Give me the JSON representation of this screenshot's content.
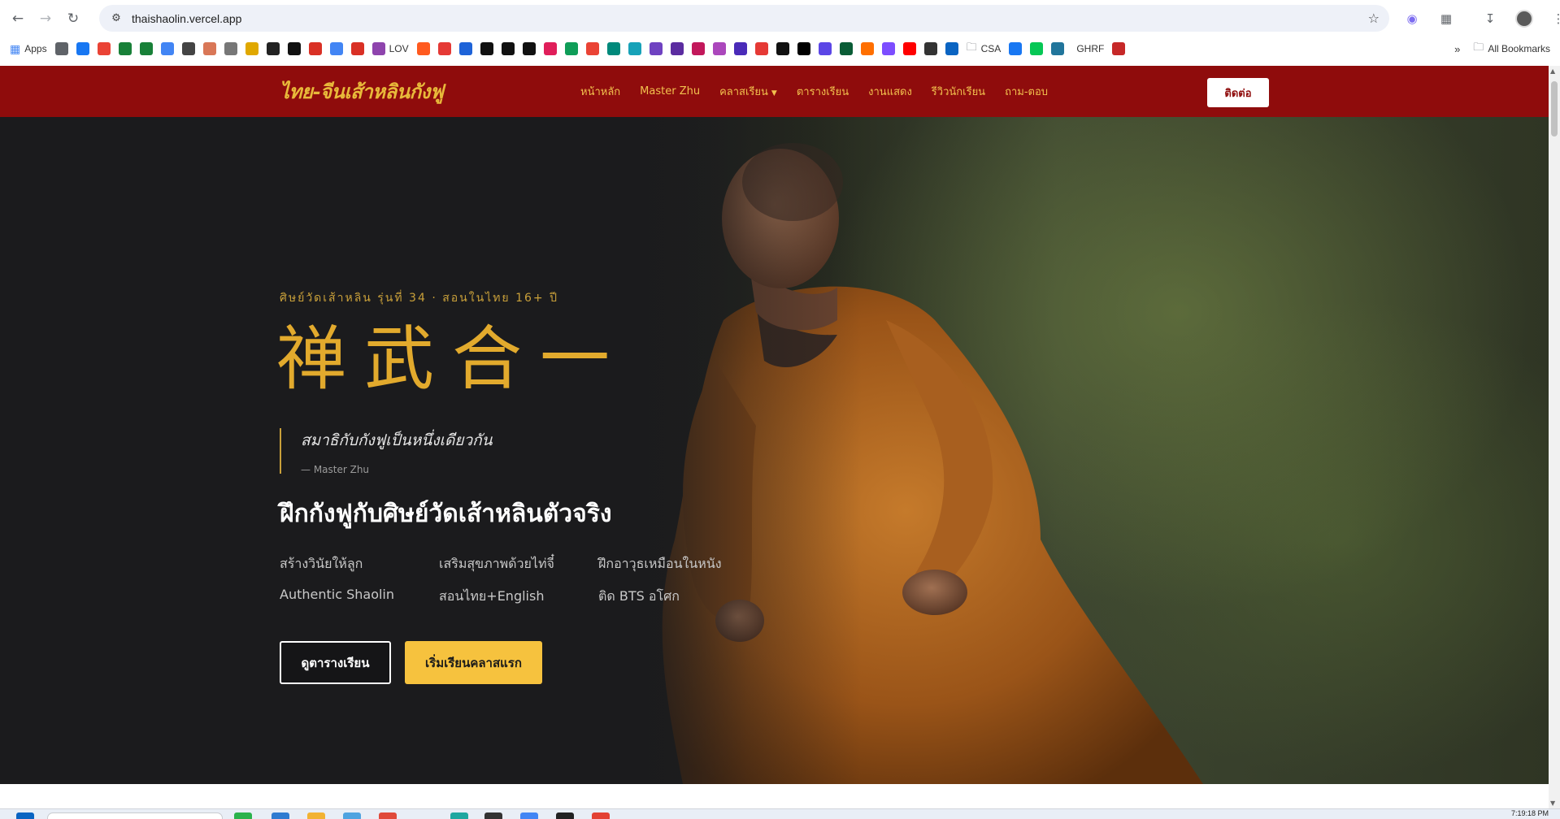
{
  "browser": {
    "url": "thaishaolin.vercel.app",
    "bookmarks": {
      "apps_label": "Apps",
      "items": [
        {
          "icon": "grid-icon",
          "color": "#5f6368"
        },
        {
          "icon": "facebook-icon",
          "color": "#1877f2"
        },
        {
          "icon": "gmail-icon",
          "color": "#ea4335"
        },
        {
          "icon": "sheets-icon",
          "color": "#188038"
        },
        {
          "icon": "sheets-icon",
          "color": "#188038"
        },
        {
          "icon": "gemini-icon",
          "color": "#4285f4"
        },
        {
          "icon": "openai-icon",
          "color": "#444444"
        },
        {
          "icon": "claude-icon",
          "color": "#d97757"
        },
        {
          "icon": "feather-icon",
          "color": "#777777"
        },
        {
          "icon": "coin-icon",
          "color": "#e0a800"
        },
        {
          "icon": "circle-icon",
          "color": "#222222"
        },
        {
          "icon": "notion-icon",
          "color": "#111111"
        },
        {
          "icon": "play-icon",
          "color": "#d93025"
        },
        {
          "icon": "calendar-icon",
          "color": "#4285f4"
        },
        {
          "icon": "badge-icon",
          "color": "#d93025"
        }
      ],
      "lov_label": "LOV",
      "items2": [
        {
          "icon": "bolt-icon",
          "color": "#ff5a1f"
        },
        {
          "icon": "music-icon",
          "color": "#e53935"
        },
        {
          "icon": "dr-icon",
          "color": "#1e63d8"
        },
        {
          "icon": "play-circle-icon",
          "color": "#111111"
        },
        {
          "icon": "github-icon",
          "color": "#111111"
        },
        {
          "icon": "github-icon",
          "color": "#111111"
        },
        {
          "icon": "slack-icon",
          "color": "#e01e5a"
        },
        {
          "icon": "drive-icon",
          "color": "#0f9d58"
        },
        {
          "icon": "gmail-icon",
          "color": "#ea4335"
        },
        {
          "icon": "chat-icon",
          "color": "#00897b"
        },
        {
          "icon": "frame-icon",
          "color": "#17a2b8"
        },
        {
          "icon": "camera-icon",
          "color": "#6f42c1"
        },
        {
          "icon": "triangle-icon",
          "color": "#5b2ca0"
        },
        {
          "icon": "paint-icon",
          "color": "#c2185b"
        },
        {
          "icon": "link-icon",
          "color": "#ab47bc"
        },
        {
          "icon": "hub-icon",
          "color": "#4a2bb8"
        },
        {
          "icon": "screen-icon",
          "color": "#e53935"
        },
        {
          "icon": "chart-icon",
          "color": "#111111"
        },
        {
          "icon": "vercel-icon",
          "color": "#000000"
        },
        {
          "icon": "chat-bubble-icon",
          "color": "#5b46e6"
        },
        {
          "icon": "terminal-icon",
          "color": "#0a5c36"
        },
        {
          "icon": "a-icon",
          "color": "#ff6f00"
        },
        {
          "icon": "gem-icon",
          "color": "#7c4dff"
        },
        {
          "icon": "youtube-icon",
          "color": "#ff0000"
        },
        {
          "icon": "bag-icon",
          "color": "#333333"
        },
        {
          "icon": "outlook-icon",
          "color": "#0a64c2"
        }
      ],
      "csa_label": "CSA",
      "items3": [
        {
          "icon": "facebook-icon",
          "color": "#1877f2"
        },
        {
          "icon": "line-icon",
          "color": "#06c755"
        },
        {
          "icon": "wordpress-icon",
          "color": "#21759b"
        }
      ],
      "ghrf_label": "GHRF",
      "items4": [
        {
          "icon": "shield-icon",
          "color": "#c62828"
        }
      ],
      "all_bookmarks_label": "All Bookmarks"
    },
    "clock": "7:19:18 PM"
  },
  "site": {
    "brand": "ไทย-จีนเส้าหลินกังฟู",
    "nav": [
      "หน้าหลัก",
      "Master Zhu",
      "คลาสเรียน",
      "ตารางเรียน",
      "งานแสดง",
      "รีวิวนักเรียน",
      "ถาม-ตอบ"
    ],
    "contact_button": "ติดต่อ",
    "colors": {
      "nav_bg": "#8f0c0c",
      "accent": "#f6c23e",
      "gold": "#e2aa2d"
    }
  },
  "hero": {
    "eyebrow": "ศิษย์วัดเส้าหลิน รุ่นที่ 34 · สอนในไทย 16+ ปี",
    "calligraphy": "禅武合一",
    "quote": "สมาธิกับกังฟูเป็นหนึ่งเดียวกัน",
    "quote_author": "— Master Zhu",
    "headline": "ฝึกกังฟูกับศิษย์วัดเส้าหลินตัวจริง",
    "features": [
      "สร้างวินัยให้ลูก",
      "เสริมสุขภาพด้วยไท่จี๋",
      "ฝึกอาวุธเหมือนในหนัง",
      "Authentic Shaolin",
      "สอนไทย+English",
      "ติด BTS อโศก"
    ],
    "btn_schedule": "ดูตารางเรียน",
    "btn_start": "เริ่มเรียนคลาสแรก"
  }
}
